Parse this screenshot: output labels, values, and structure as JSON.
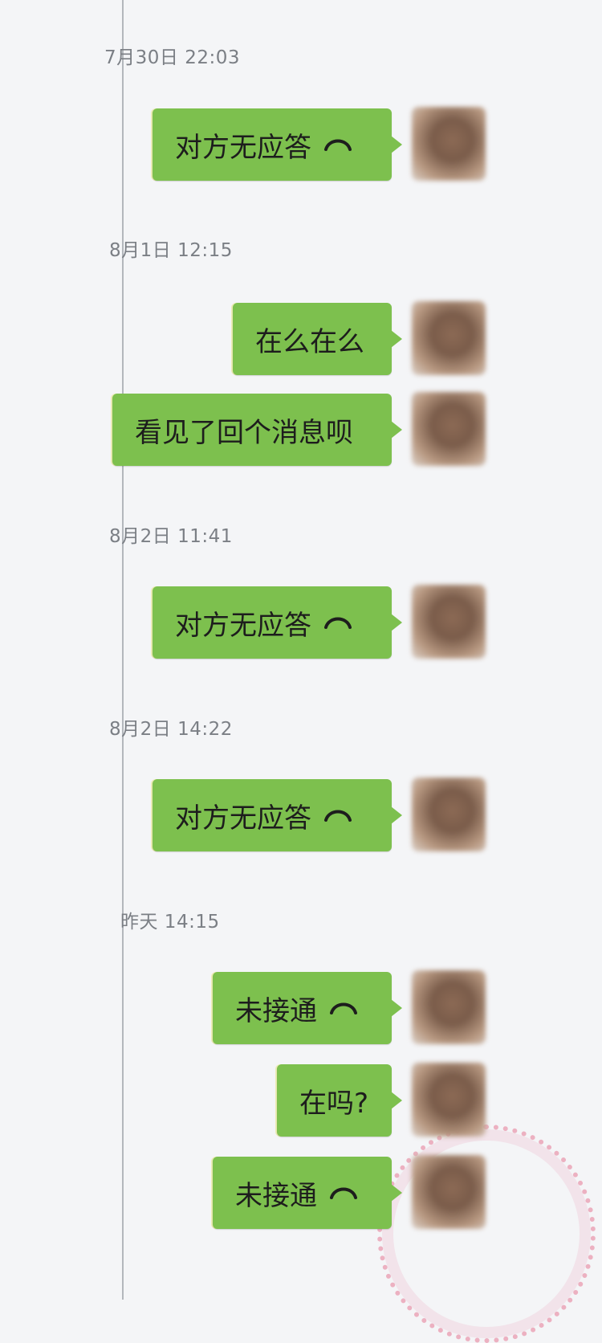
{
  "messages": [
    {
      "time": "7月30日 22:03",
      "bubbles": [
        {
          "text": "对方无应答",
          "icon": "phone-hangup-icon"
        }
      ]
    },
    {
      "time": "8月1日 12:15",
      "bubbles": [
        {
          "text": "在么在么"
        },
        {
          "text": "看见了回个消息呗"
        }
      ]
    },
    {
      "time": "8月2日 11:41",
      "bubbles": [
        {
          "text": "对方无应答",
          "icon": "phone-hangup-icon"
        }
      ]
    },
    {
      "time": "8月2日 14:22",
      "bubbles": [
        {
          "text": "对方无应答",
          "icon": "phone-hangup-icon"
        }
      ]
    },
    {
      "time": "昨天 14:15",
      "bubbles": [
        {
          "text": "未接通",
          "icon": "phone-hangup-icon"
        },
        {
          "text": "在吗?"
        },
        {
          "text": "未接通",
          "icon": "phone-hangup-icon"
        }
      ]
    }
  ],
  "colors": {
    "bubble": "#7dc04e",
    "timestamp": "#7b7f85",
    "background": "#f4f5f7"
  }
}
